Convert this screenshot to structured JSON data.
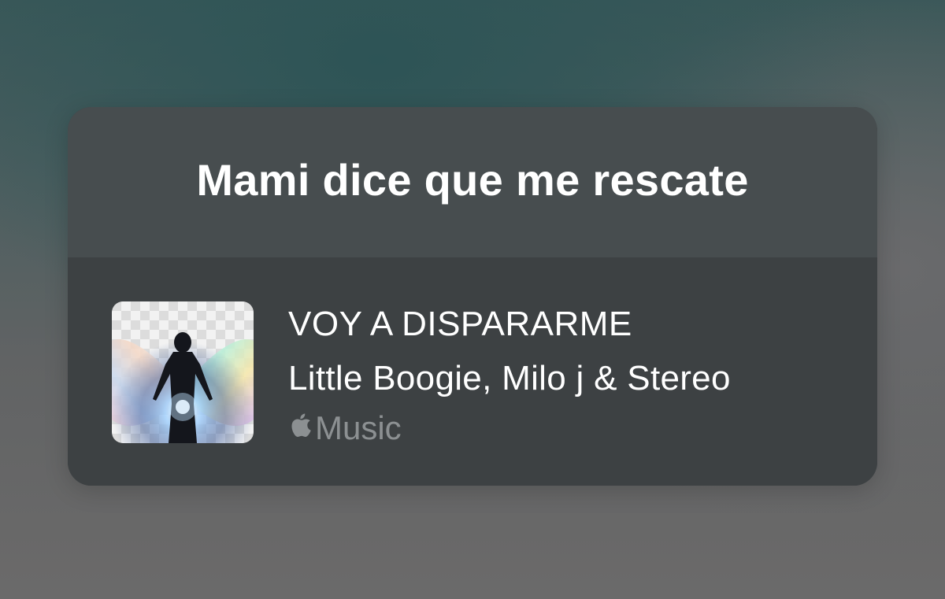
{
  "lyric": {
    "text": "Mami dice que me rescate"
  },
  "song": {
    "title": "VOY A DISPARARME",
    "artist": "Little Boogie, Milo j & Stereo",
    "service_label": "Music",
    "service_icon": "apple-logo-icon"
  },
  "colors": {
    "card_top": "#484e50",
    "card_bottom": "#3d4143",
    "text_primary": "#ffffff",
    "text_secondary": "#8c9092"
  }
}
